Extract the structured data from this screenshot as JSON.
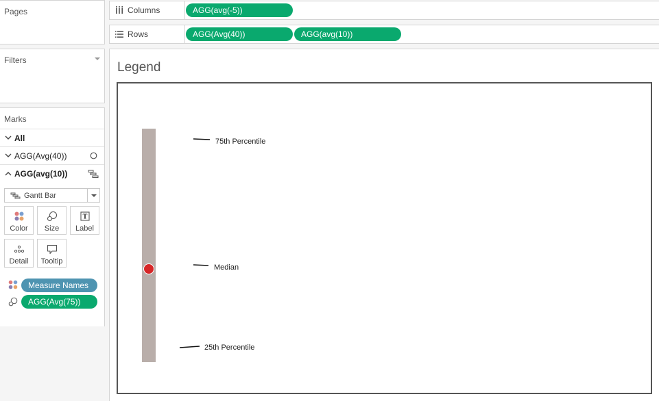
{
  "cards": {
    "pages_title": "Pages",
    "filters_title": "Filters",
    "marks_title": "Marks"
  },
  "marks": {
    "rows": [
      {
        "label": "All",
        "expanded": false,
        "icon": "none"
      },
      {
        "label": "AGG(Avg(40))",
        "expanded": false,
        "icon": "circle-mark-icon"
      },
      {
        "label": "AGG(avg(10))",
        "expanded": true,
        "icon": "gantt-mark-icon"
      }
    ],
    "mark_type": "Gantt Bar",
    "buttons": {
      "color": "Color",
      "size": "Size",
      "label": "Label",
      "detail": "Detail",
      "tooltip": "Tooltip"
    },
    "pills": [
      {
        "label": "Measure Names",
        "encoding": "color",
        "color": "#4e94b1"
      },
      {
        "label": "AGG(Avg(75))",
        "encoding": "size",
        "color": "#0aa96e"
      }
    ]
  },
  "shelves": {
    "columns": {
      "label": "Columns",
      "pills": [
        "AGG(avg(-5))"
      ]
    },
    "rows": {
      "label": "Rows",
      "pills": [
        "AGG(Avg(40))",
        "AGG(avg(10))"
      ]
    }
  },
  "view": {
    "title": "Legend",
    "annotations": {
      "p75": "75th Percentile",
      "median": "Median",
      "p25": "25th Percentile"
    }
  },
  "colors": {
    "pill_green": "#0aa96e",
    "pill_blue": "#4e94b1",
    "gantt_bar": "#b9aeaa",
    "median_dot": "#d62728"
  }
}
